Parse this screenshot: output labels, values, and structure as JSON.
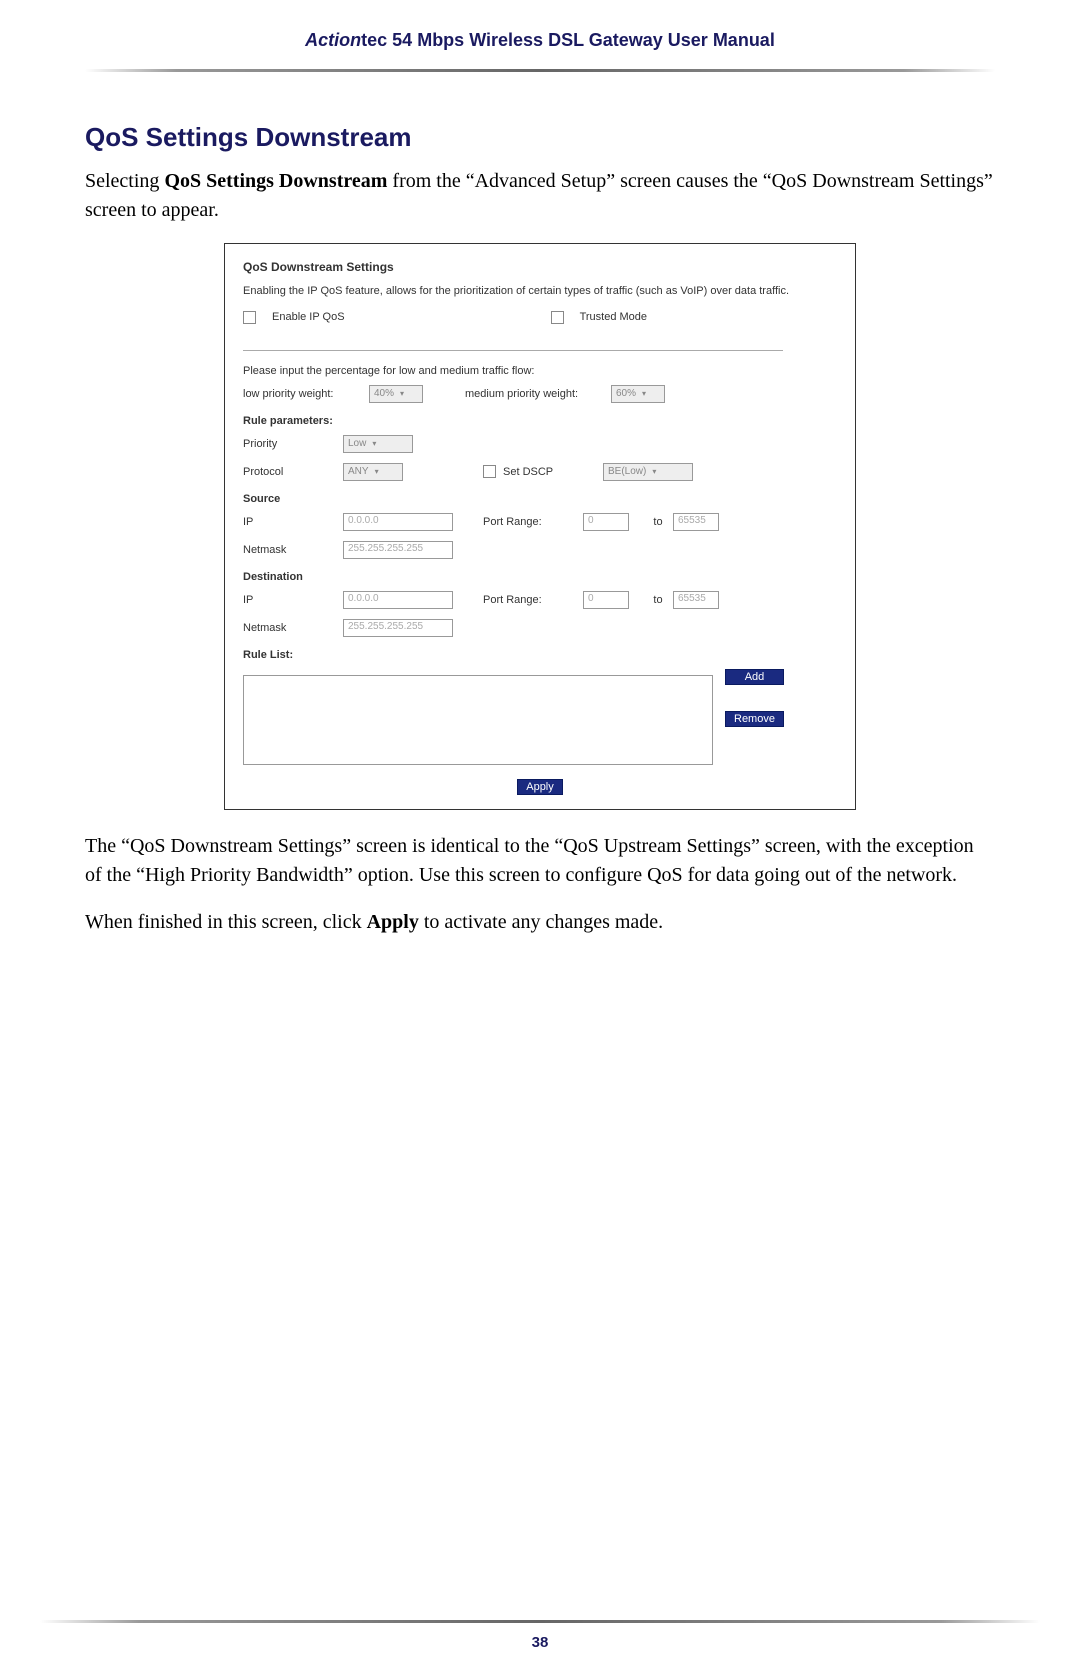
{
  "header": {
    "brand_italic": "Action",
    "brand_rest": "tec",
    "title_rest": " 54 Mbps Wireless DSL Gateway User Manual"
  },
  "section": {
    "heading": "QoS Settings Downstream",
    "para1_pre": "Selecting ",
    "para1_bold": "QoS Settings Downstream",
    "para1_post": " from the “Advanced Setup” screen causes the “QoS Downstream Settings” screen to appear.",
    "para2": "The “QoS Downstream Settings” screen is identical to the “QoS Upstream Settings” screen, with the exception of the “High Priority Bandwidth” option. Use this screen to configure QoS for data going out of the network.",
    "para3_pre": "When finished in this screen, click ",
    "para3_bold": "Apply",
    "para3_post": " to activate any changes made."
  },
  "screenshot": {
    "title": "QoS Downstream Settings",
    "desc": "Enabling the IP QoS feature, allows for the prioritization of certain types of traffic (such as VoIP) over data traffic.",
    "enable_label": "Enable IP QoS",
    "trusted_label": "Trusted Mode",
    "pct_prompt": "Please input the percentage for low and medium traffic flow:",
    "low_weight_label": "low priority weight:",
    "low_weight_value": "40%",
    "med_weight_label": "medium priority weight:",
    "med_weight_value": "60%",
    "rule_params": "Rule parameters:",
    "priority_label": "Priority",
    "priority_value": "Low",
    "protocol_label": "Protocol",
    "protocol_value": "ANY",
    "set_dscp_label": "Set DSCP",
    "dscp_value": "BE(Low)",
    "source_label": "Source",
    "ip_label": "IP",
    "netmask_label": "Netmask",
    "dest_label": "Destination",
    "port_range_label": "Port Range:",
    "to_label": "to",
    "ip_placeholder": "0.0.0.0",
    "netmask_placeholder": "255.255.255.255",
    "port_from_placeholder": "0",
    "port_to_placeholder": "65535",
    "rule_list_label": "Rule List:",
    "add_btn": "Add",
    "remove_btn": "Remove",
    "apply_btn": "Apply"
  },
  "page_number": "38"
}
